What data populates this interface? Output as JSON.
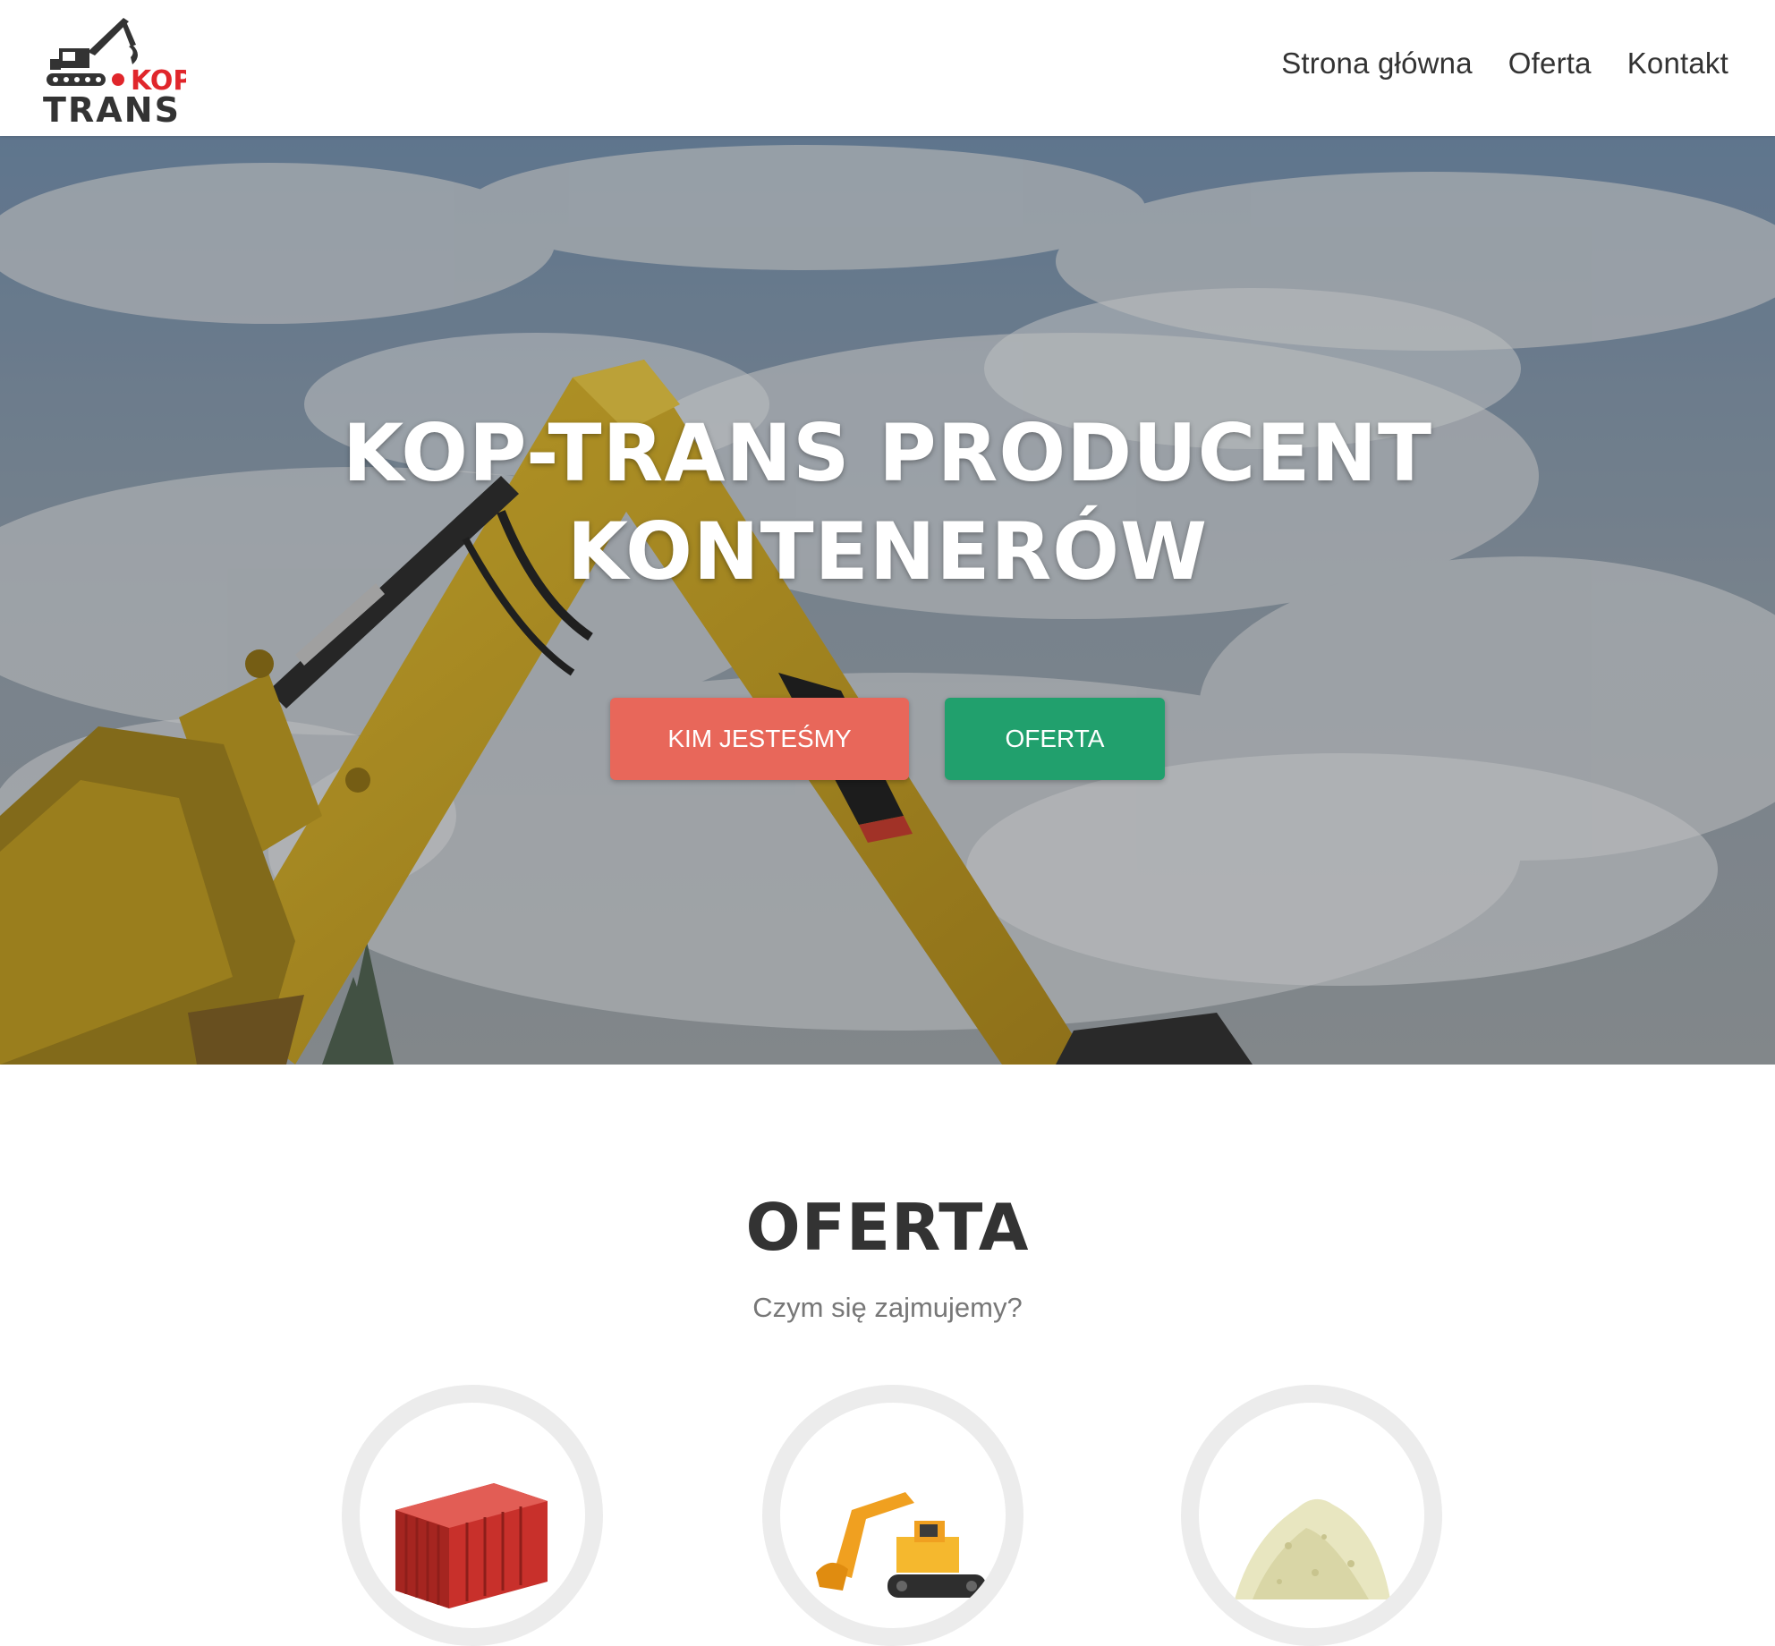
{
  "header": {
    "logo": {
      "line1": "KOP",
      "line2": "TRANS",
      "icon": "excavator-logo-icon"
    },
    "nav": [
      {
        "label": "Strona główna"
      },
      {
        "label": "Oferta"
      },
      {
        "label": "Kontakt"
      }
    ]
  },
  "hero": {
    "title_line1": "KOP-TRANS PRODUCENT",
    "title_line2": "KONTENERÓW",
    "background": "excavator-arm-against-cloudy-sky",
    "buttons": {
      "primary": "KIM JESTEŚMY",
      "secondary": "OFERTA"
    }
  },
  "offer": {
    "title": "OFERTA",
    "subtitle": "Czym się zajmujemy?",
    "items": [
      {
        "icon": "shipping-container-icon"
      },
      {
        "icon": "excavator-icon"
      },
      {
        "icon": "sand-pile-icon"
      }
    ]
  },
  "colors": {
    "accent_red": "#e8675a",
    "accent_green": "#21a06d",
    "logo_red": "#e0262b",
    "text_dark": "#333333"
  }
}
